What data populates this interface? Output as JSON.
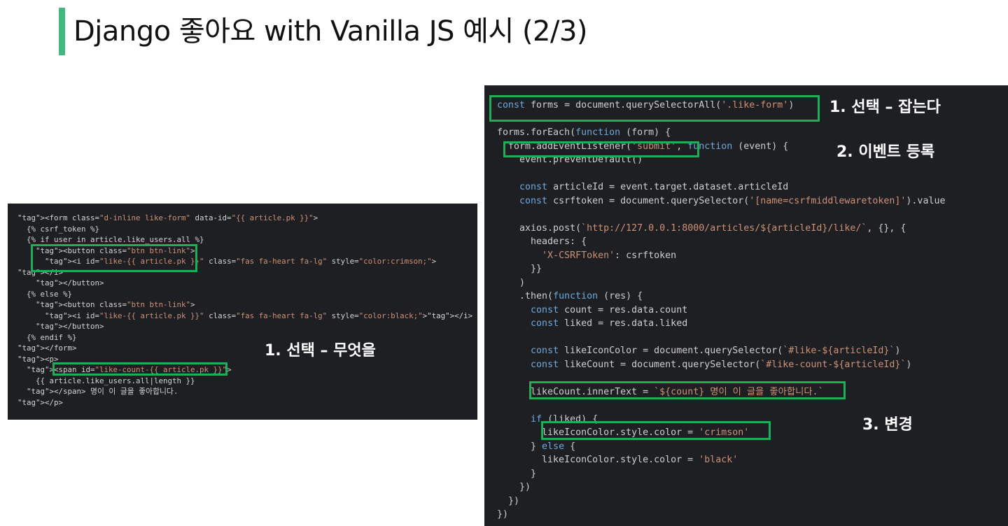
{
  "slide": {
    "title": "Django 좋아요 with Vanilla JS 예시 (2/3)",
    "accent_color": "#3fb97f",
    "highlight_color": "#1fae55"
  },
  "left_panel": {
    "lines": [
      "<form class=\"d-inline like-form\" data-id=\"{{ article.pk }}\">",
      "  {% csrf_token %}",
      "  {% if user in article.like_users.all %}",
      "    <button class=\"btn btn-link\">",
      "      <i id=\"like-{{ article.pk }}\" class=\"fas fa-heart fa-lg\" style=\"color:crimson;\">",
      "</i>",
      "    </button>",
      "  {% else %}",
      "    <button class=\"btn btn-link\">",
      "      <i id=\"like-{{ article.pk }}\" class=\"fas fa-heart fa-lg\" style=\"color:black;\"></i>",
      "    </button>",
      "  {% endif %}",
      "</form>",
      "<p>",
      "  <span id=\"like-count-{{ article.pk }}\">",
      "    {{ article.like_users.all|length }}",
      "  </span> 명이 이 글을 좋아합니다.",
      "</p>"
    ],
    "annotation": "1. 선택 – 무엇을"
  },
  "right_panel": {
    "lines": [
      "const forms = document.querySelectorAll('.like-form')",
      "",
      "forms.forEach(function (form) {",
      "  form.addEventListener('submit', function (event) {",
      "    event.preventDefault()",
      "",
      "    const articleId = event.target.dataset.articleId",
      "    const csrftoken = document.querySelector('[name=csrfmiddlewaretoken]').value",
      "",
      "    axios.post(`http://127.0.0.1:8000/articles/${articleId}/like/`, {}, {",
      "      headers: {",
      "        'X-CSRFToken': csrftoken",
      "      }}",
      "    )",
      "    .then(function (res) {",
      "      const count = res.data.count",
      "      const liked = res.data.liked",
      "",
      "      const likeIconColor = document.querySelector(`#like-${articleId}`)",
      "      const likeCount = document.querySelector(`#like-count-${articleId}`)",
      "",
      "      likeCount.innerText = `${count} 명이 이 글을 좋아합니다.`",
      "",
      "      if (liked) {",
      "        likeIconColor.style.color = 'crimson'",
      "      } else {",
      "        likeIconColor.style.color = 'black'",
      "      }",
      "    })",
      "  })",
      "})"
    ],
    "annotations": {
      "select": "1. 선택 – 잡는다",
      "event": "2. 이벤트 등록",
      "change": "3. 변경"
    }
  }
}
